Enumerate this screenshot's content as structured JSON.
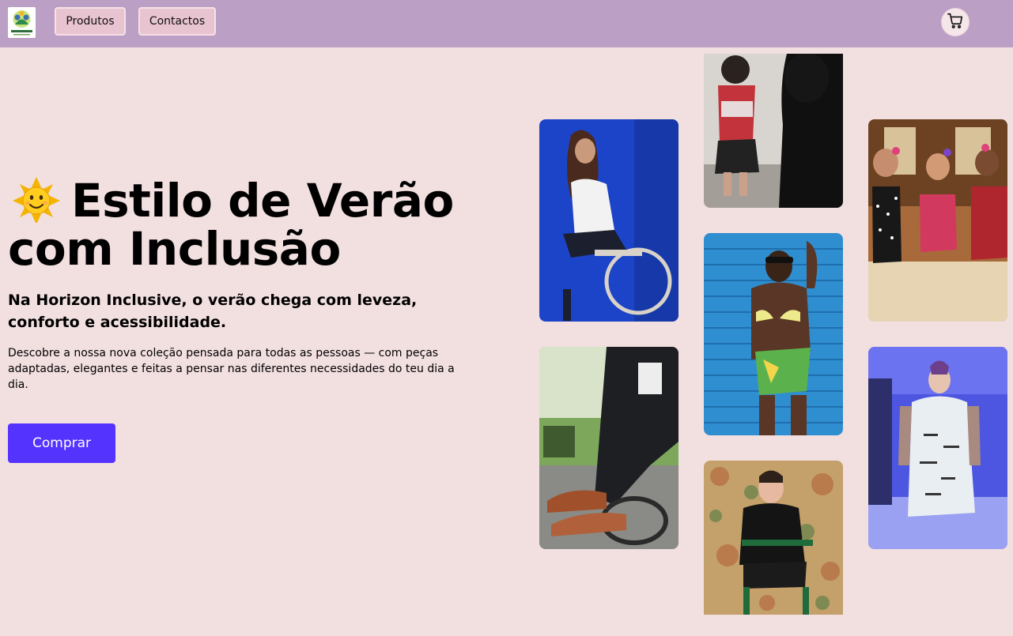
{
  "header": {
    "logo_icon": "horizon-logo",
    "nav": [
      {
        "label": "Produtos"
      },
      {
        "label": "Contactos"
      }
    ],
    "cart_icon": "shopping-cart-icon"
  },
  "hero": {
    "title_line1": "Estilo de Verão",
    "title_line2": "com Inclusão",
    "title_icon": "sun-emoji-icon",
    "subtitle": "Na Horizon Inclusive, o verão chega com leveza, conforto e acessibilidade.",
    "description": "Descobre a nossa nova coleção pensada para todas as pessoas — com peças adaptadas, elegantes e feitas a pensar nas diferentes necessidades do teu dia a dia.",
    "cta_label": "Comprar"
  },
  "colors": {
    "header_bg": "#bc9fc5",
    "page_bg": "#f2dfe0",
    "nav_button_bg": "#e8c3d0",
    "cta_bg": "#5533ff"
  },
  "gallery": [
    {
      "name": "photo-woman-wheelchair-blue"
    },
    {
      "name": "photo-man-wheelchair-park"
    },
    {
      "name": "photo-child-fitting"
    },
    {
      "name": "photo-woman-bikini-blue-wall"
    },
    {
      "name": "photo-man-floral-background"
    },
    {
      "name": "photo-women-beach"
    },
    {
      "name": "photo-model-runway"
    }
  ]
}
